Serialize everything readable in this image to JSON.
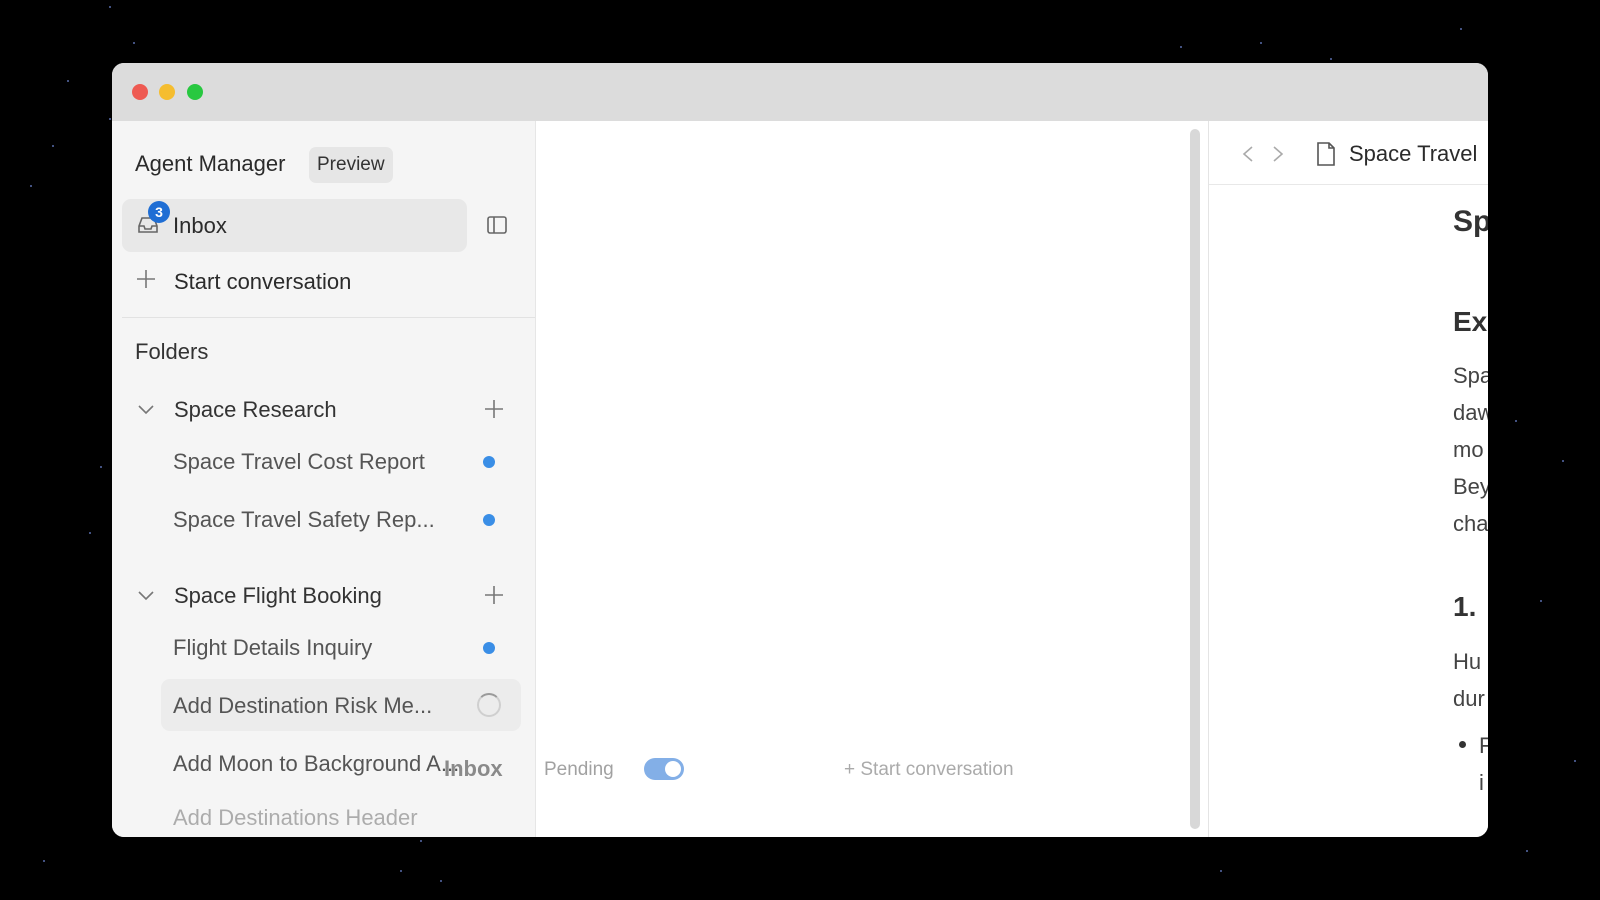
{
  "app": {
    "title": "Agent Manager",
    "badge": "Preview"
  },
  "sidebar": {
    "inbox_label": "Inbox",
    "inbox_count": "3",
    "start_conversation": "Start conversation",
    "folders_heading": "Folders",
    "folders": [
      {
        "name": "Space Research",
        "items": [
          {
            "label": "Space Travel Cost Report",
            "status": "unread"
          },
          {
            "label": "Space Travel Safety Rep...",
            "status": "unread"
          }
        ]
      },
      {
        "name": "Space Flight Booking",
        "items": [
          {
            "label": "Flight Details Inquiry",
            "status": "unread"
          },
          {
            "label": "Add Destination Risk Me...",
            "status": "loading"
          },
          {
            "label": "Add Moon to Background A...",
            "status": "none"
          },
          {
            "label": "Add Destinations Header",
            "status": "none"
          }
        ]
      }
    ]
  },
  "center": {
    "footer_title": "Inbox",
    "pending_label": "Pending",
    "start_conversation": "Start conversation"
  },
  "document": {
    "title": "Space Travel",
    "heading": "Sp",
    "subheading": "Ex",
    "paragraph_fragments": [
      "Spa",
      "daw",
      "mo",
      "Bey",
      "cha"
    ],
    "section": "1.",
    "section_fragments": [
      "Hu",
      "dur"
    ],
    "bullet_fragments": [
      "F",
      "i"
    ]
  },
  "colors": {
    "accent": "#1f6ed4",
    "unread_dot": "#3a8ee6"
  }
}
